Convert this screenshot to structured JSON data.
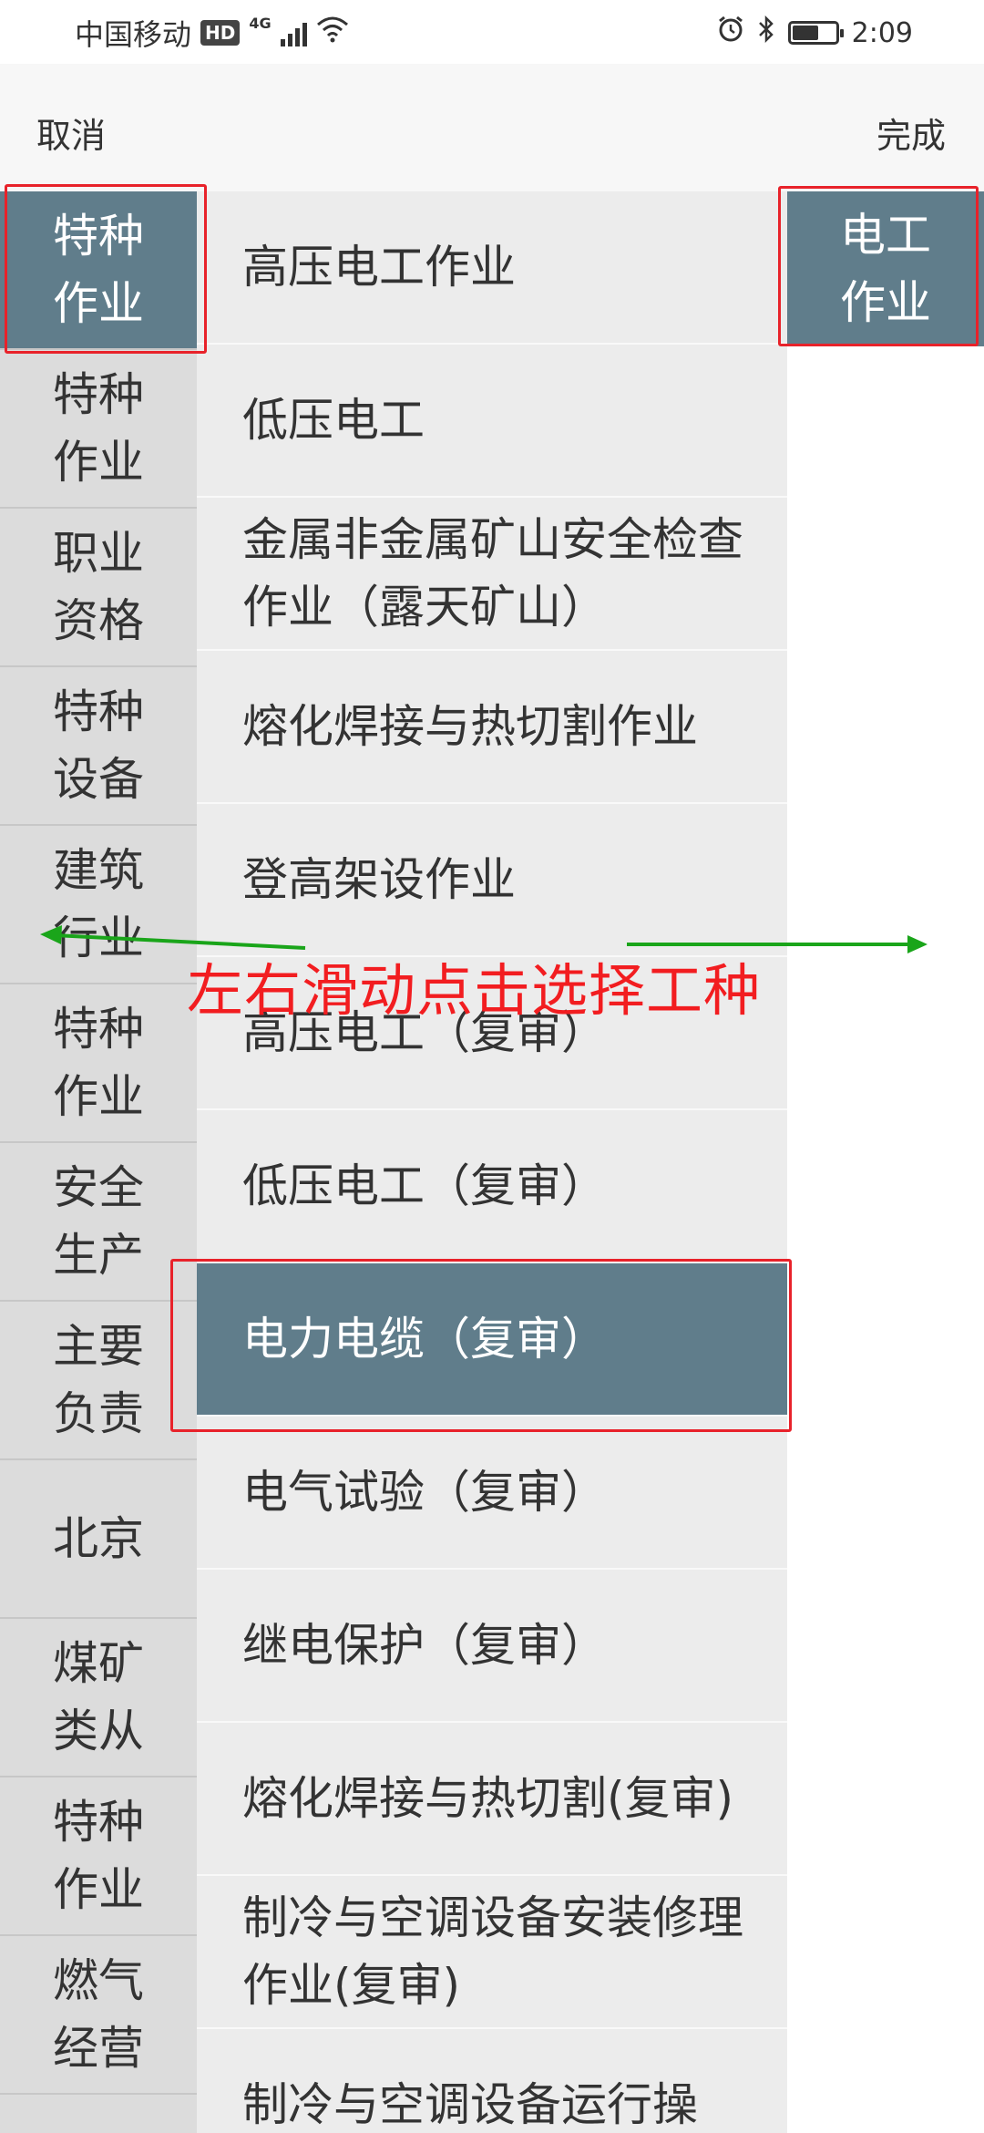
{
  "status_bar": {
    "carrier": "中国移动",
    "hd": "HD",
    "network": "4G",
    "time": "2:09",
    "icons": [
      "signal-icon",
      "wifi-icon",
      "alarm-icon",
      "bluetooth-icon",
      "battery-icon"
    ],
    "battery_level_fraction": 0.6
  },
  "header": {
    "cancel_label": "取消",
    "done_label": "完成"
  },
  "left_column": {
    "selected_index": 0,
    "items": [
      "特种作业",
      "特种作业",
      "职业资格",
      "特种设备",
      "建筑行业",
      "特种作业",
      "安全生产",
      "主要负责",
      "北京",
      "煤矿类从",
      "特种作业",
      "燃气经营"
    ]
  },
  "middle_column": {
    "selected_index": 7,
    "items": [
      "高压电工作业",
      "低压电工",
      "金属非金属矿山安全检查作业（露天矿山）",
      "熔化焊接与热切割作业",
      "登高架设作业",
      "高压电工（复审）",
      "低压电工（复审）",
      "电力电缆（复审）",
      "电气试验（复审）",
      "继电保护（复审）",
      "熔化焊接与热切割(复审)",
      "制冷与空调设备安装修理作业(复审)",
      "制冷与空调设备运行操"
    ]
  },
  "right_column": {
    "items": [
      "电工作业"
    ]
  },
  "annotation": {
    "caption": "左右滑动点击选择工种",
    "highlight_color": "#e8222a",
    "arrow_color": "#1aa51a"
  },
  "colors": {
    "selected_bg": "#607d8b",
    "left_bg": "#dcdcdc",
    "middle_bg": "#ececec",
    "header_bg": "#f7f7f7"
  }
}
